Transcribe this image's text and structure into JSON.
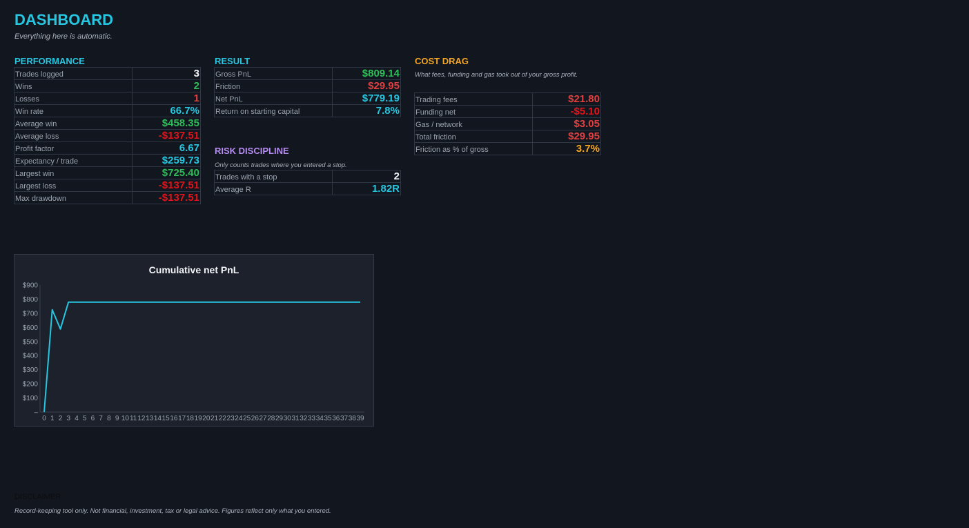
{
  "header": {
    "title": "DASHBOARD",
    "subtitle": "Everything here is automatic."
  },
  "performance": {
    "title": "PERFORMANCE",
    "rows": [
      {
        "label": "Trades logged",
        "value": "3",
        "color": "#f2f4f7"
      },
      {
        "label": "Wins",
        "value": "2",
        "color": "#2ebd58"
      },
      {
        "label": "Losses",
        "value": "1",
        "color": "#e0403f"
      },
      {
        "label": "Win rate",
        "value": "66.7%",
        "color": "#27c6e0"
      },
      {
        "label": "Average win",
        "value": "$458.35",
        "color": "#2ebd58"
      },
      {
        "label": "Average loss",
        "value": "-$137.51",
        "color": "#e0151b"
      },
      {
        "label": "Profit factor",
        "value": "6.67",
        "color": "#27c6e0"
      },
      {
        "label": "Expectancy / trade",
        "value": "$259.73",
        "color": "#27c6e0"
      },
      {
        "label": "Largest win",
        "value": "$725.40",
        "color": "#2ebd58"
      },
      {
        "label": "Largest loss",
        "value": "-$137.51",
        "color": "#e0151b"
      },
      {
        "label": "Max drawdown",
        "value": "-$137.51",
        "color": "#e0151b"
      }
    ]
  },
  "result": {
    "title": "RESULT",
    "rows": [
      {
        "label": "Gross PnL",
        "value": "$809.14",
        "color": "#2ebd58"
      },
      {
        "label": "Friction",
        "value": "$29.95",
        "color": "#e0403f"
      },
      {
        "label": "Net PnL",
        "value": "$779.19",
        "color": "#27c6e0"
      },
      {
        "label": "Return on starting capital",
        "value": "7.8%",
        "color": "#27c6e0"
      }
    ]
  },
  "risk": {
    "title": "RISK DISCIPLINE",
    "note": "Only counts trades where you entered a stop.",
    "rows": [
      {
        "label": "Trades with a stop",
        "value": "2",
        "color": "#f2f4f7"
      },
      {
        "label": "Average R",
        "value": "1.82R",
        "color": "#27c6e0"
      }
    ]
  },
  "cost": {
    "title": "COST DRAG",
    "note": "What fees, funding and gas took out of your gross profit.",
    "rows": [
      {
        "label": "Trading fees",
        "value": "$21.80",
        "color": "#e0403f"
      },
      {
        "label": "Funding net",
        "value": "-$5.10",
        "color": "#e0151b"
      },
      {
        "label": "Gas / network",
        "value": "$3.05",
        "color": "#e0403f"
      },
      {
        "label": "Total friction",
        "value": "$29.95",
        "color": "#e0403f"
      },
      {
        "label": "Friction as % of gross",
        "value": "3.7%",
        "color": "#f5a623"
      }
    ]
  },
  "colors": {
    "accent": "#27c6e0",
    "risk_title": "#b58cf0",
    "cost_title": "#f5a623",
    "line": "#27c6e0"
  },
  "chart_data": {
    "type": "line",
    "title": "Cumulative net PnL",
    "xlabel": "",
    "ylabel": "",
    "x": [
      0,
      1,
      2,
      3,
      4,
      5,
      6,
      7,
      8,
      9,
      10,
      11,
      12,
      13,
      14,
      15,
      16,
      17,
      18,
      19,
      20,
      21,
      22,
      23,
      24,
      25,
      26,
      27,
      28,
      29,
      30,
      31,
      32,
      33,
      34,
      35,
      36,
      37,
      38,
      39
    ],
    "series": [
      {
        "values": [
          0,
          725.4,
          587.89,
          779.19,
          779.19,
          779.19,
          779.19,
          779.19,
          779.19,
          779.19,
          779.19,
          779.19,
          779.19,
          779.19,
          779.19,
          779.19,
          779.19,
          779.19,
          779.19,
          779.19,
          779.19,
          779.19,
          779.19,
          779.19,
          779.19,
          779.19,
          779.19,
          779.19,
          779.19,
          779.19,
          779.19,
          779.19,
          779.19,
          779.19,
          779.19,
          779.19,
          779.19,
          779.19,
          779.19,
          779.19
        ]
      }
    ],
    "ylim": [
      0,
      900
    ],
    "y_ticks": [
      0,
      100,
      200,
      300,
      400,
      500,
      600,
      700,
      800,
      900
    ],
    "y_tick_labels": [
      "–",
      "$100",
      "$200",
      "$300",
      "$400",
      "$500",
      "$600",
      "$700",
      "$800",
      "$900"
    ],
    "grid": false,
    "legend": "none"
  },
  "disclaimer": {
    "title": "DISCLAIMER",
    "text": "Record-keeping tool only. Not financial, investment, tax or legal advice. Figures reflect only what you entered."
  }
}
